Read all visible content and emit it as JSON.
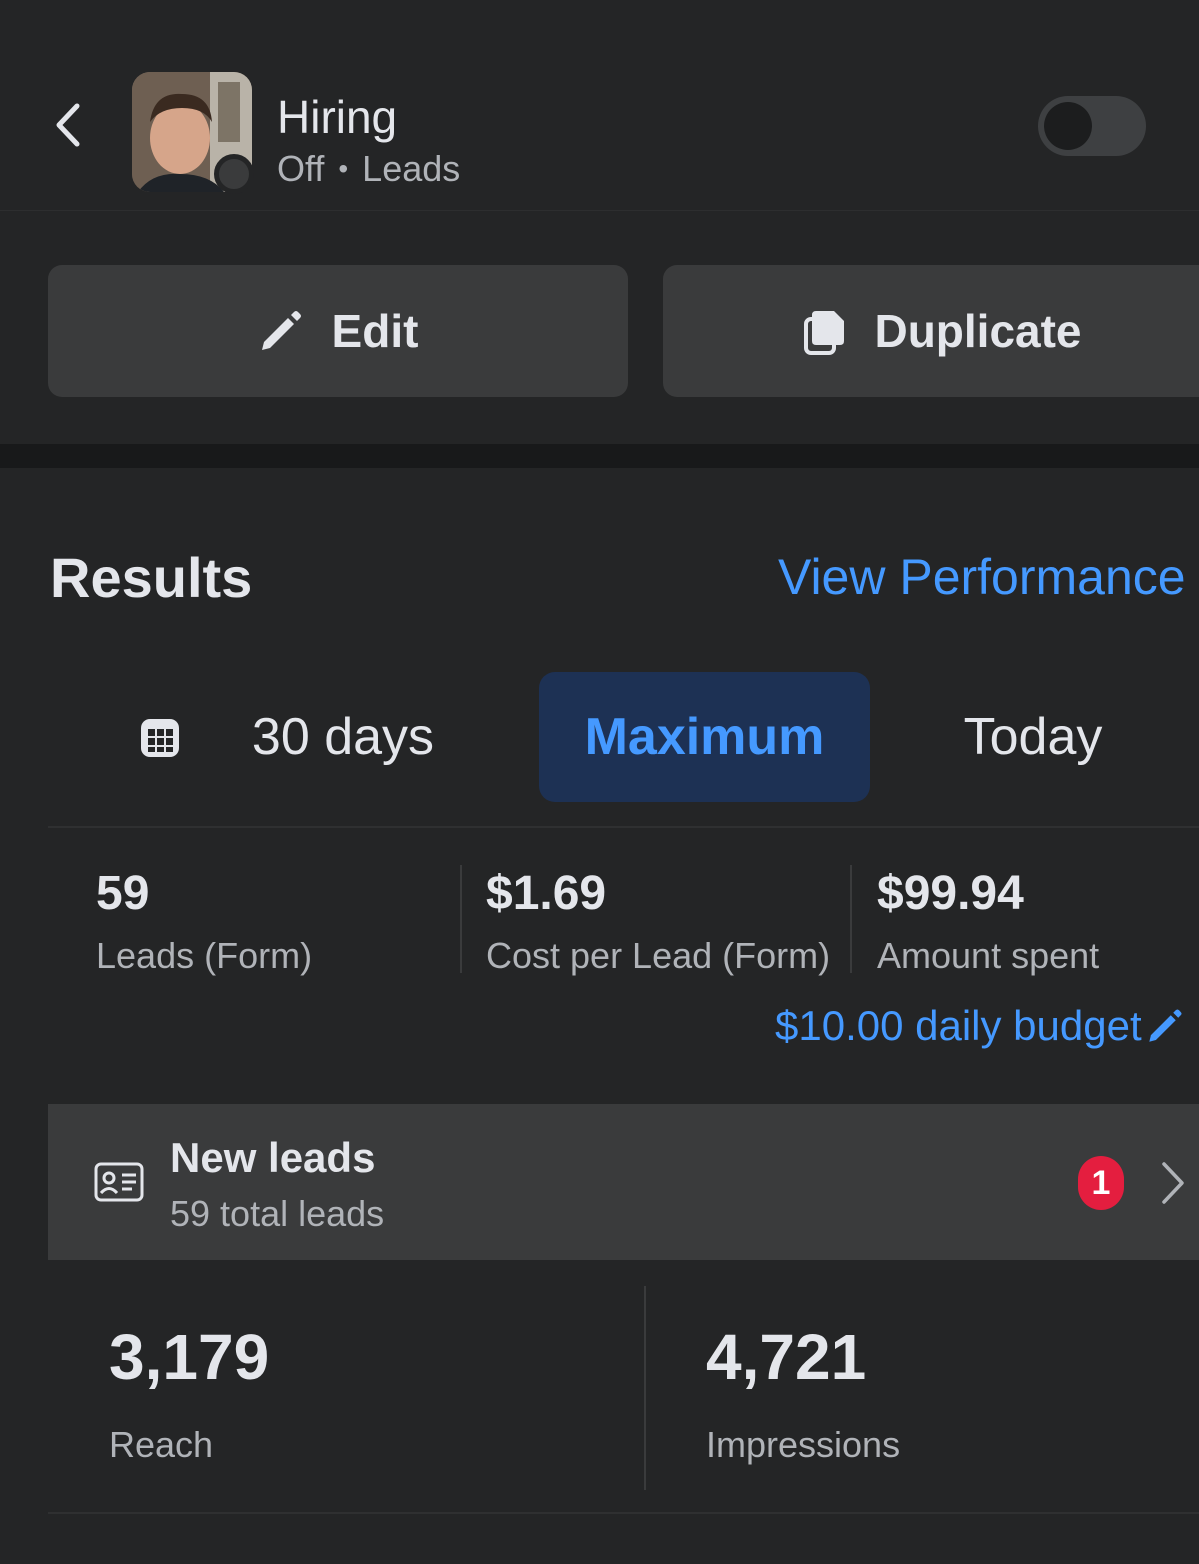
{
  "header": {
    "campaign_title": "Hiring",
    "status": "Off",
    "objective": "Leads",
    "separator": "•"
  },
  "actions": {
    "edit_label": "Edit",
    "duplicate_label": "Duplicate"
  },
  "results": {
    "title": "Results",
    "view_performance_label": "View Performance",
    "periods": [
      "30 days",
      "Maximum",
      "Today"
    ],
    "selected_period": "Maximum",
    "metrics": [
      {
        "value": "59",
        "label": "Leads (Form)"
      },
      {
        "value": "$1.69",
        "label": "Cost per Lead (Form)"
      },
      {
        "value": "$99.94",
        "label": "Amount spent"
      }
    ],
    "budget_label": "$10.00 daily budget",
    "new_leads": {
      "title": "New leads",
      "subtitle": "59 total leads",
      "badge_count": "1"
    },
    "stats": [
      {
        "value": "3,179",
        "label": "Reach"
      },
      {
        "value": "4,721",
        "label": "Impressions"
      }
    ]
  },
  "icons": {
    "back": "chevron-left-icon",
    "edit": "pencil-icon",
    "duplicate": "copy-icon",
    "calendar": "calendar-icon",
    "lead_form": "id-card-icon",
    "forward": "chevron-right-icon"
  },
  "colors": {
    "background": "#242526",
    "accent": "#4599ff",
    "selected_segment": "#1d3154",
    "badge": "#e41e3f"
  }
}
